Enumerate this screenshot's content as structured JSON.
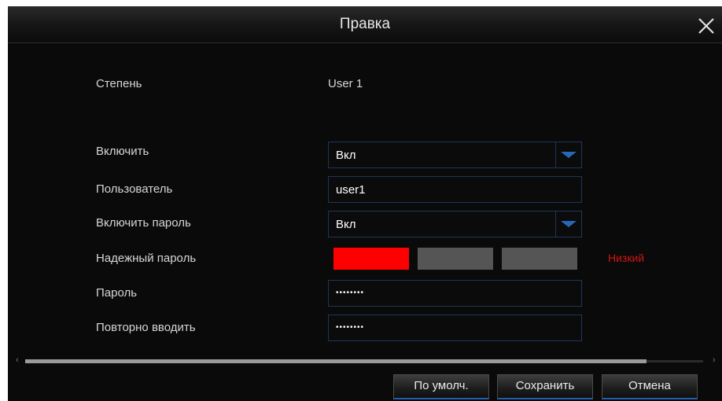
{
  "dialog": {
    "title": "Правка",
    "close_icon": "close-icon"
  },
  "form": {
    "level": {
      "label": "Степень",
      "value": "User 1"
    },
    "enable": {
      "label": "Включить",
      "value": "Вкл"
    },
    "user": {
      "label": "Пользователь",
      "value": "user1"
    },
    "enable_password": {
      "label": "Включить пароль",
      "value": "Вкл"
    },
    "strength": {
      "label": "Надежный пароль",
      "text": "Низкий",
      "level_filled": 1,
      "level_total": 3,
      "colors": {
        "active": "#ff0000",
        "inactive": "#555555",
        "text": "#d21515"
      }
    },
    "password": {
      "label": "Пароль",
      "value": "••••••••"
    },
    "confirm": {
      "label": "Повторно вводить",
      "value": "••••••••"
    }
  },
  "buttons": {
    "default": "По умолч.",
    "save": "Сохранить",
    "cancel": "Отмена"
  },
  "accent": "#2767b8"
}
